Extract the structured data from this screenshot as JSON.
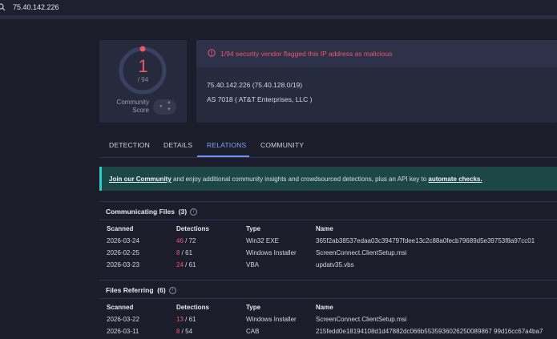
{
  "search": {
    "value": "75.40.142.226"
  },
  "score": {
    "detected": "1",
    "total": "/ 94",
    "community_label": "Community Score"
  },
  "alert": {
    "text": "1/94 security vendor flagged this IP address as malicious"
  },
  "ip_info": {
    "ip_line": "75.40.142.226  (75.40.128.0/19)",
    "as_line": "AS 7018  ( AT&T Enterprises, LLC )"
  },
  "tabs": [
    {
      "label": "DETECTION",
      "active": false
    },
    {
      "label": "DETAILS",
      "active": false
    },
    {
      "label": "RELATIONS",
      "active": true
    },
    {
      "label": "COMMUNITY",
      "active": false
    }
  ],
  "banner": {
    "link1": "Join our Community",
    "text": " and enjoy additional community insights and crowdsourced detections, plus an API key to ",
    "link2": "automate checks."
  },
  "columns": {
    "scanned": "Scanned",
    "detections": "Detections",
    "type": "Type",
    "name": "Name"
  },
  "communicating_files": {
    "title": "Communicating Files",
    "count": "(3)",
    "rows": [
      {
        "scanned": "2026-03-24",
        "det": "46",
        "det_total": " / 72",
        "type": "Win32 EXE",
        "name": "365f2ab38537edaa03c394797fdee13c2c88a0fecb79689d5e39753f8a97cc01"
      },
      {
        "scanned": "2026-02-25",
        "det": "8",
        "det_total": " / 61",
        "type": "Windows Installer",
        "name": "ScreenConnect.ClientSetup.msi"
      },
      {
        "scanned": "2026-03-23",
        "det": "24",
        "det_total": " / 61",
        "type": "VBA",
        "name": "updatv35.vbs"
      }
    ]
  },
  "files_referring": {
    "title": "Files Referring",
    "count": "(6)",
    "rows": [
      {
        "scanned": "2026-03-22",
        "det": "13",
        "det_total": " / 61",
        "type": "Windows Installer",
        "name": "ScreenConnect.ClientSetup.msi"
      },
      {
        "scanned": "2026-03-11",
        "det": "8",
        "det_total": " / 54",
        "type": "CAB",
        "name": "215fedd0e18194108d1d47882dc066b5535936026250089867 99d16cc67a4ba7"
      }
    ]
  },
  "colors": {
    "malicious": "#f0566a",
    "accent": "#6f8fff",
    "banner": "#1d4746"
  }
}
